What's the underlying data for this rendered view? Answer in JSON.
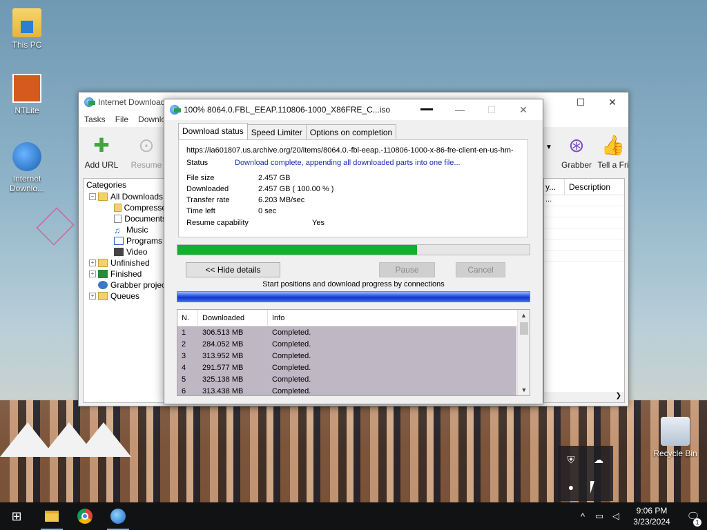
{
  "desktop": {
    "icons": [
      {
        "label": "This PC",
        "icon": "this-pc-icon"
      },
      {
        "label": "NTLite",
        "icon": "ntlite-icon"
      },
      {
        "label": "Internet Downlo...",
        "icon": "idm-icon"
      },
      {
        "label": "Recycle Bin",
        "icon": "recycle-bin-icon"
      }
    ]
  },
  "main_window": {
    "title": "Internet Download",
    "controls": {
      "maximize": "☐",
      "close": "✕"
    },
    "menu": [
      "Tasks",
      "File",
      "Downloa"
    ],
    "toolbar": {
      "add_url": "Add URL",
      "resume": "Resume",
      "grabber": "Grabber",
      "tell_friend": "Tell a Fri"
    },
    "categories": {
      "header": "Categories",
      "items": [
        {
          "label": "All Downloads",
          "level": 0,
          "expander": "−"
        },
        {
          "label": "Compresse",
          "level": 1
        },
        {
          "label": "Documents",
          "level": 1
        },
        {
          "label": "Music",
          "level": 1
        },
        {
          "label": "Programs",
          "level": 1
        },
        {
          "label": "Video",
          "level": 1
        },
        {
          "label": "Unfinished",
          "level": 0,
          "expander": "+"
        },
        {
          "label": "Finished",
          "level": 0,
          "expander": "+"
        },
        {
          "label": "Grabber projec",
          "level": 0
        },
        {
          "label": "Queues",
          "level": 0,
          "expander": "+"
        }
      ]
    },
    "list": {
      "col_partial": "y...",
      "col_description": "Description",
      "first_cell": "..."
    }
  },
  "dialog": {
    "title": "100% 8064.0.FBL_EEAP.110806-1000_X86FRE_C...iso",
    "controls": {
      "minimize": "—",
      "maximize": "☐",
      "close": "✕"
    },
    "tabs": [
      "Download status",
      "Speed Limiter",
      "Options on completion"
    ],
    "url": "https://ia601807.us.archive.org/20/items/8064.0.-fbl-eeap.-110806-1000-x-86-fre-client-en-us-hm-",
    "status_label": "Status",
    "status_value": "Download complete, appending all downloaded parts into one file...",
    "file_size_label": "File size",
    "file_size_value": "2.457  GB",
    "downloaded_label": "Downloaded",
    "downloaded_value": "2.457  GB  ( 100.00 % )",
    "transfer_rate_label": "Transfer rate",
    "transfer_rate_value": "6.203  MB/sec",
    "time_left_label": "Time left",
    "time_left_value": "0 sec",
    "resume_label": "Resume capability",
    "resume_value": "Yes",
    "progress_fraction": 0.68,
    "buttons": {
      "hide_details": "<< Hide details",
      "pause": "Pause",
      "cancel": "Cancel"
    },
    "connections_label": "Start positions and download progress by connections",
    "table": {
      "headers": [
        "N.",
        "Downloaded",
        "Info"
      ],
      "rows": [
        {
          "n": "1",
          "downloaded": "306.513  MB",
          "info": "Completed."
        },
        {
          "n": "2",
          "downloaded": "284.052  MB",
          "info": "Completed."
        },
        {
          "n": "3",
          "downloaded": "313.952  MB",
          "info": "Completed."
        },
        {
          "n": "4",
          "downloaded": "291.577  MB",
          "info": "Completed."
        },
        {
          "n": "5",
          "downloaded": "325.138  MB",
          "info": "Completed."
        },
        {
          "n": "6",
          "downloaded": "313.438  MB",
          "info": "Completed."
        }
      ]
    }
  },
  "taskbar": {
    "clock_time": "9:06 PM",
    "clock_date": "3/23/2024",
    "notification_count": "1",
    "tray_symbols": {
      "chevron": "^",
      "network": "▭",
      "volume": "◁"
    }
  },
  "colors": {
    "progress_green": "#12b02c",
    "status_blue": "#1a2fb0",
    "row_bg": "#bfb7c3"
  }
}
